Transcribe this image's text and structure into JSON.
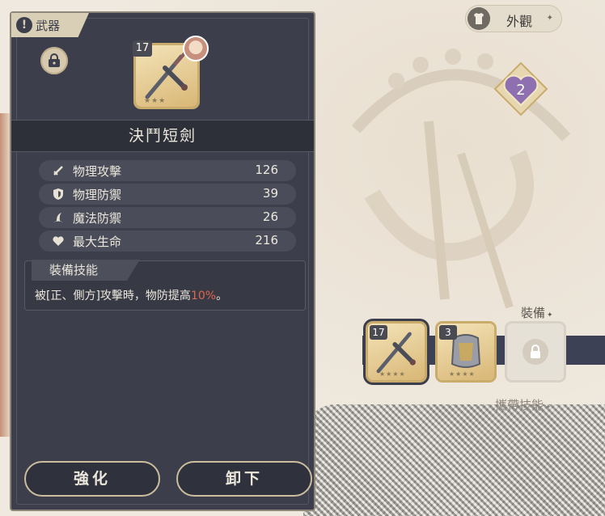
{
  "panel": {
    "category": "武器",
    "weapon_name": "決鬥短劍",
    "weapon_level": "17",
    "stats": [
      {
        "icon": "sword-icon",
        "label": "物理攻擊",
        "value": "126"
      },
      {
        "icon": "shield-icon",
        "label": "物理防禦",
        "value": "39"
      },
      {
        "icon": "magic-hat-icon",
        "label": "魔法防禦",
        "value": "26"
      },
      {
        "icon": "heart-icon",
        "label": "最大生命",
        "value": "216"
      }
    ],
    "skill": {
      "title": "裝備技能",
      "desc_prefix": "被[正、側方]攻擊時，物防提高",
      "desc_highlight": "10%",
      "desc_suffix": "。"
    },
    "buttons": {
      "enhance": "強化",
      "unequip": "卸下"
    }
  },
  "right": {
    "appearance_label": "外觀",
    "heart_badge_value": "2",
    "equip_label": "裝備",
    "carry_label": "攜帶技能",
    "slots": [
      {
        "type": "weapon",
        "level": "17"
      },
      {
        "type": "armor",
        "level": "3"
      },
      {
        "type": "locked"
      }
    ]
  },
  "colors": {
    "panel_bg": "#3c3f4b",
    "highlight": "#e0674f",
    "gold_frame": "#c9ab6c"
  }
}
